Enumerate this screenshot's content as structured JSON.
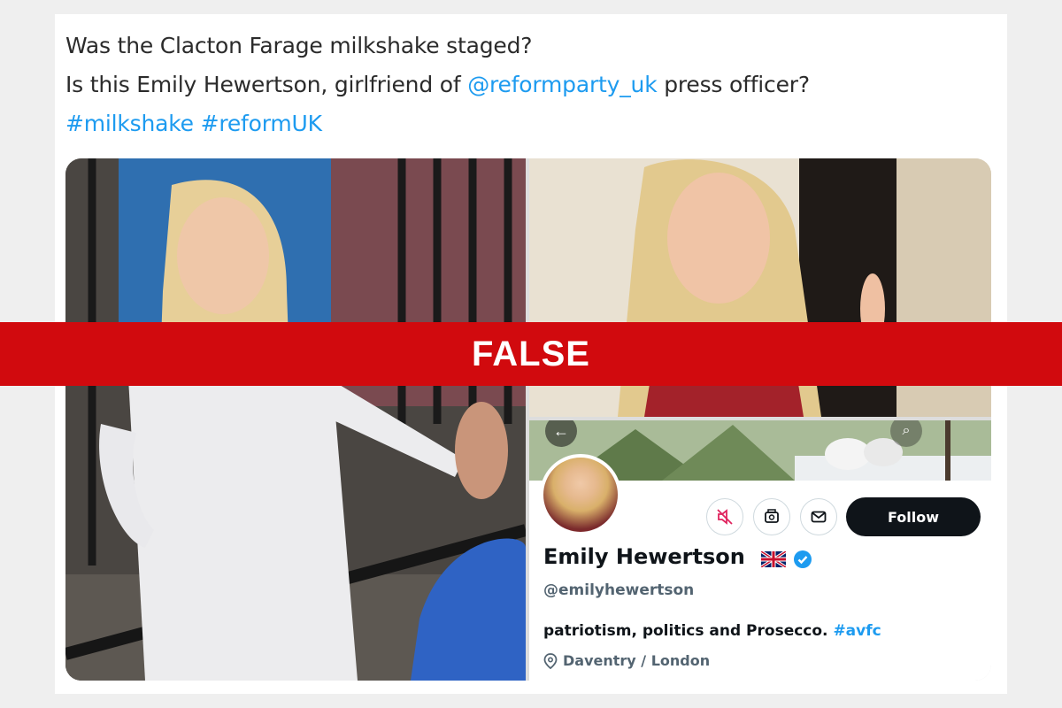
{
  "tweet": {
    "line1": "Was the Clacton Farage milkshake staged?",
    "line2_prefix": "Is this Emily Hewertson, girlfriend of ",
    "line2_mention": "@reformparty_uk",
    "line2_suffix": " press officer?",
    "hashtag1": "#milkshake",
    "hashtag2": "#reformUK"
  },
  "profile": {
    "display_name": "Emily Hewertson",
    "flag": "uk-flag-icon",
    "verified": "verified-badge-icon",
    "handle": "@emilyhewertson",
    "bio_text": "patriotism, politics and Prosecco. ",
    "bio_hashtag": "#avfc",
    "location": "Daventry / London",
    "follow_label": "Follow",
    "icons": [
      "mute-icon",
      "subscribe-icon",
      "message-icon"
    ]
  },
  "verdict": {
    "label": "FALSE",
    "color": "#d10a0e"
  },
  "colors": {
    "link": "#1d9bf0",
    "text": "#2b2b2b",
    "follow_bg": "#0f1419"
  }
}
